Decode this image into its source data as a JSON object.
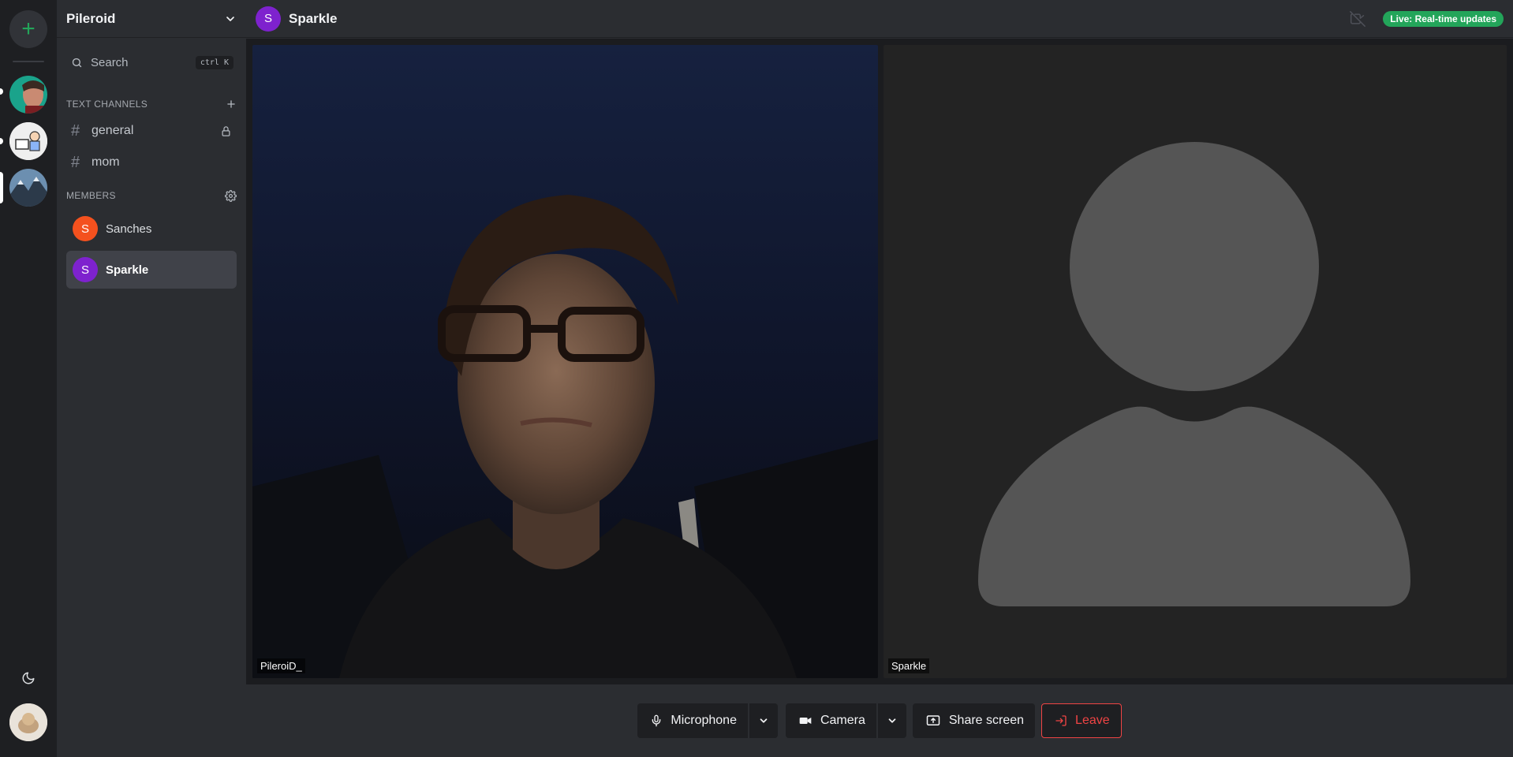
{
  "rail": {
    "add_icon": "plus-icon",
    "servers": [
      "server-avatar-portrait",
      "server-avatar-cartoon",
      "server-avatar-landscape"
    ]
  },
  "sidebar": {
    "server_name": "Pileroid",
    "search": {
      "label": "Search",
      "shortcut": "ctrl K"
    },
    "text_channels_heading": "TEXT CHANNELS",
    "channels": [
      {
        "name": "general",
        "locked": true
      },
      {
        "name": "mom",
        "locked": false
      }
    ],
    "members_heading": "MEMBERS",
    "members": [
      {
        "initial": "S",
        "name": "Sanches",
        "color": "#f4511e",
        "active": false
      },
      {
        "initial": "S",
        "name": "Sparkle",
        "color": "#7e22ce",
        "active": true
      }
    ]
  },
  "header": {
    "avatar_initial": "S",
    "title": "Sparkle",
    "live_badge": "Live: Real-time updates",
    "camera_status_icon": "camera-off-icon"
  },
  "stage": {
    "tiles": [
      {
        "name": "PileroiD_",
        "camera_on": true
      },
      {
        "name": "Sparkle",
        "camera_on": false
      }
    ]
  },
  "controls": {
    "microphone": "Microphone",
    "camera": "Camera",
    "share_screen": "Share screen",
    "leave": "Leave"
  },
  "colors": {
    "accent_green": "#23a55a",
    "leave_red": "#ef4444",
    "sanches_orange": "#f4511e",
    "sparkle_purple": "#7e22ce"
  }
}
